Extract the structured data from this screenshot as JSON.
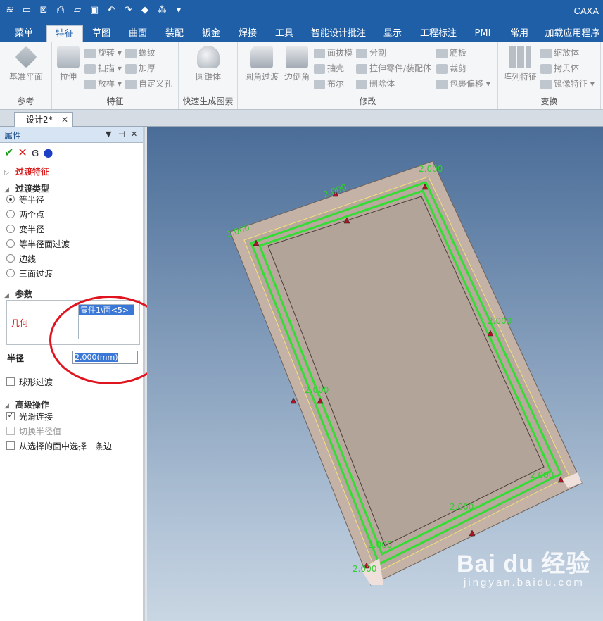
{
  "app": {
    "title": "CAXA"
  },
  "quick_access": [
    "layers-icon",
    "new-file-icon",
    "close-file-icon",
    "print-preview-icon",
    "open-folder-icon",
    "save-icon",
    "undo-icon",
    "redo-icon",
    "part-icon",
    "rebuild-icon",
    "dropdown-icon"
  ],
  "tabs": [
    "菜单",
    "特征",
    "草图",
    "曲面",
    "装配",
    "钣金",
    "焊接",
    "工具",
    "智能设计批注",
    "显示",
    "工程标注",
    "PMI",
    "常用",
    "加载应用程序"
  ],
  "active_tab": "特征",
  "ribbon": {
    "groups": [
      {
        "label": "参考"
      },
      {
        "label": "特征"
      },
      {
        "label": "快速生成图素"
      },
      {
        "label": "修改"
      },
      {
        "label": "变换"
      }
    ],
    "buttons": {
      "datum_plane": "基准平面",
      "extrude": "拉伸",
      "revolve": "旋转",
      "sweep": "扫描",
      "loft": "放样",
      "thread": "螺纹",
      "thicken": "加厚",
      "custom_hole": "自定义孔",
      "cone": "圆锥体",
      "fillet": "圆角过渡",
      "chamfer": "边倒角",
      "face_draft": "面拔模",
      "shell": "抽壳",
      "boolean": "布尔",
      "split": "分割",
      "extrude_to_part": "拉伸零件/装配体",
      "remove_body": "删除体",
      "rib": "筋板",
      "trim": "裁剪",
      "wrap_offset": "包裹偏移",
      "pattern": "阵列特征",
      "scale": "缩放体",
      "copy_body": "拷贝体",
      "mirror": "镜像特征"
    }
  },
  "document_tab": {
    "label": "设计2*",
    "close": "✕"
  },
  "panel": {
    "title": "属性",
    "controls": {
      "menu": "▼",
      "pin": "⊣",
      "close": "✕"
    },
    "tools": {
      "ok": "✔",
      "cancel": "✕",
      "preview": "ɞ",
      "help": "●"
    },
    "feature_title": "过渡特征",
    "type_section": "过渡类型",
    "types": [
      "等半径",
      "两个点",
      "变半径",
      "等半径面过渡",
      "边线",
      "三面过渡"
    ],
    "selected_type": 0,
    "param_section": "参数",
    "geometry_label": "几何",
    "geometry_selected": "零件1\\面<5>",
    "radius_label": "半径",
    "radius_value": "2.000(mm)",
    "spherical_fillet": "球形过渡",
    "advanced_section": "高级操作",
    "smooth_connect": "光滑连接",
    "smooth_connect_checked": true,
    "switch_radius": "切换半径值",
    "select_edge_from_face": "从选择的面中选择一条边"
  },
  "viewport": {
    "dimension_labels": [
      "2.000",
      "2.000",
      "2.000",
      "2.000",
      "2.000",
      "2.000",
      "2.000",
      "2.000",
      "2.000"
    ]
  },
  "watermark": {
    "brand": "Bai du 经验",
    "url": "jingyan.baidu.com"
  },
  "colors": {
    "title_bar": "#1f5fa8",
    "highlight": "#33dd33",
    "part_face": "#b3a49a",
    "annotation_red": "#e0141e"
  }
}
